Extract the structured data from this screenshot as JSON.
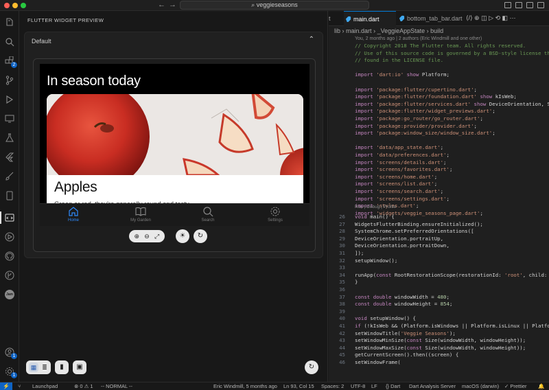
{
  "titlebar": {
    "search": "veggieseasons",
    "back": "←",
    "forward": "→"
  },
  "activity": {
    "explorer_badge": "2",
    "account_badge": "1",
    "settings_badge": "1",
    "jam_label": "Jam"
  },
  "panel": {
    "title": "FLUTTER WIDGET PREVIEW",
    "preview_name": "Default",
    "collapse": "⌃"
  },
  "app": {
    "title": "In season today",
    "card_name": "Apples",
    "card_desc": "Green or red, they're generally round and tasty.",
    "tabs": [
      {
        "label": "Home",
        "icon": "home-icon",
        "active": true
      },
      {
        "label": "My Garden",
        "icon": "book-icon",
        "active": false
      },
      {
        "label": "Search",
        "icon": "search-icon",
        "active": false
      },
      {
        "label": "Settings",
        "icon": "gear-icon",
        "active": false
      }
    ]
  },
  "editor": {
    "tabs": [
      {
        "label": "t",
        "active": false
      },
      {
        "label": "main.dart",
        "active": true
      },
      {
        "label": "bottom_tab_bar.dart",
        "active": false
      }
    ],
    "breadcrumb": {
      "folder": "lib",
      "file": "main.dart",
      "class": "_VeggieAppState",
      "method": "build"
    },
    "blame": "You, 2 months ago | 2 authors (Eric Windmill and one other)",
    "codelens": "Run | Debug | Profile",
    "header_lines": [
      "// Copyright 2018 The Flutter team. All rights reserved.",
      "// Use of this source code is governed by a BSD-style license that",
      "// found in the LICENSE file.",
      "",
      "import 'dart:io' show Platform;",
      "",
      "import 'package:flutter/cupertino.dart';",
      "import 'package:flutter/foundation.dart' show kIsWeb;",
      "import 'package:flutter/services.dart' show DeviceOrientation, Sys",
      "import 'package:flutter/widget_previews.dart';",
      "import 'package:go_router/go_router.dart';",
      "import 'package:provider/provider.dart';",
      "import 'package:window_size/window_size.dart';",
      "",
      "import 'data/app_state.dart';",
      "import 'data/preferences.dart';",
      "import 'screens/details.dart';",
      "import 'screens/favorites.dart';",
      "import 'screens/home.dart';",
      "import 'screens/list.dart';",
      "import 'screens/search.dart';",
      "import 'screens/settings.dart';",
      "import 'styles.dart';",
      "import 'widgets/veggie_seasons_page.dart';"
    ],
    "numbered_lines": [
      {
        "n": "26",
        "t": "void main() {"
      },
      {
        "n": "27",
        "t": "  WidgetsFlutterBinding.ensureInitialized();"
      },
      {
        "n": "28",
        "t": "  SystemChrome.setPreferredOrientations(["
      },
      {
        "n": "29",
        "t": "    DeviceOrientation.portraitUp,"
      },
      {
        "n": "30",
        "t": "    DeviceOrientation.portraitDown,"
      },
      {
        "n": "31",
        "t": "  ]);"
      },
      {
        "n": "32",
        "t": "  setupWindow();"
      },
      {
        "n": "33",
        "t": ""
      },
      {
        "n": "34",
        "t": "  runApp(const RootRestorationScope(restorationId: 'root', child: "
      },
      {
        "n": "35",
        "t": "}"
      },
      {
        "n": "36",
        "t": ""
      },
      {
        "n": "37",
        "t": "const double windowWidth = 480;"
      },
      {
        "n": "38",
        "t": "const double windowHeight = 854;"
      },
      {
        "n": "39",
        "t": ""
      },
      {
        "n": "40",
        "t": "void setupWindow() {"
      },
      {
        "n": "41",
        "t": "  if (!kIsWeb && (Platform.isWindows || Platform.isLinux || Platfo"
      },
      {
        "n": "42",
        "t": "    setWindowTitle('Veggie Seasons');"
      },
      {
        "n": "43",
        "t": "    setWindowMinSize(const Size(windowWidth, windowHeight));"
      },
      {
        "n": "44",
        "t": "    setWindowMaxSize(const Size(windowWidth, windowHeight));"
      },
      {
        "n": "45",
        "t": "    getCurrentScreen().then((screen) {"
      },
      {
        "n": "46",
        "t": "      setWindowFrame("
      }
    ]
  },
  "status": {
    "remote": "⚡",
    "launchpad": "Launchpad",
    "problems": "⊗ 0 ⚠ 1",
    "mode": "-- NORMAL --",
    "author": "Eric Windmill, 5 months ago",
    "position": "Ln 93, Col 15",
    "spaces": "Spaces: 2",
    "encoding": "UTF-8",
    "eol": "LF",
    "language": "{} Dart",
    "analysis": "Dart Analysis Server",
    "device": "macOS (darwin)",
    "prettier": "✓ Prettier"
  },
  "colors": {
    "accent": "#0078d4",
    "tab_active": "#2f8cff",
    "badge": "#0e63c4"
  }
}
